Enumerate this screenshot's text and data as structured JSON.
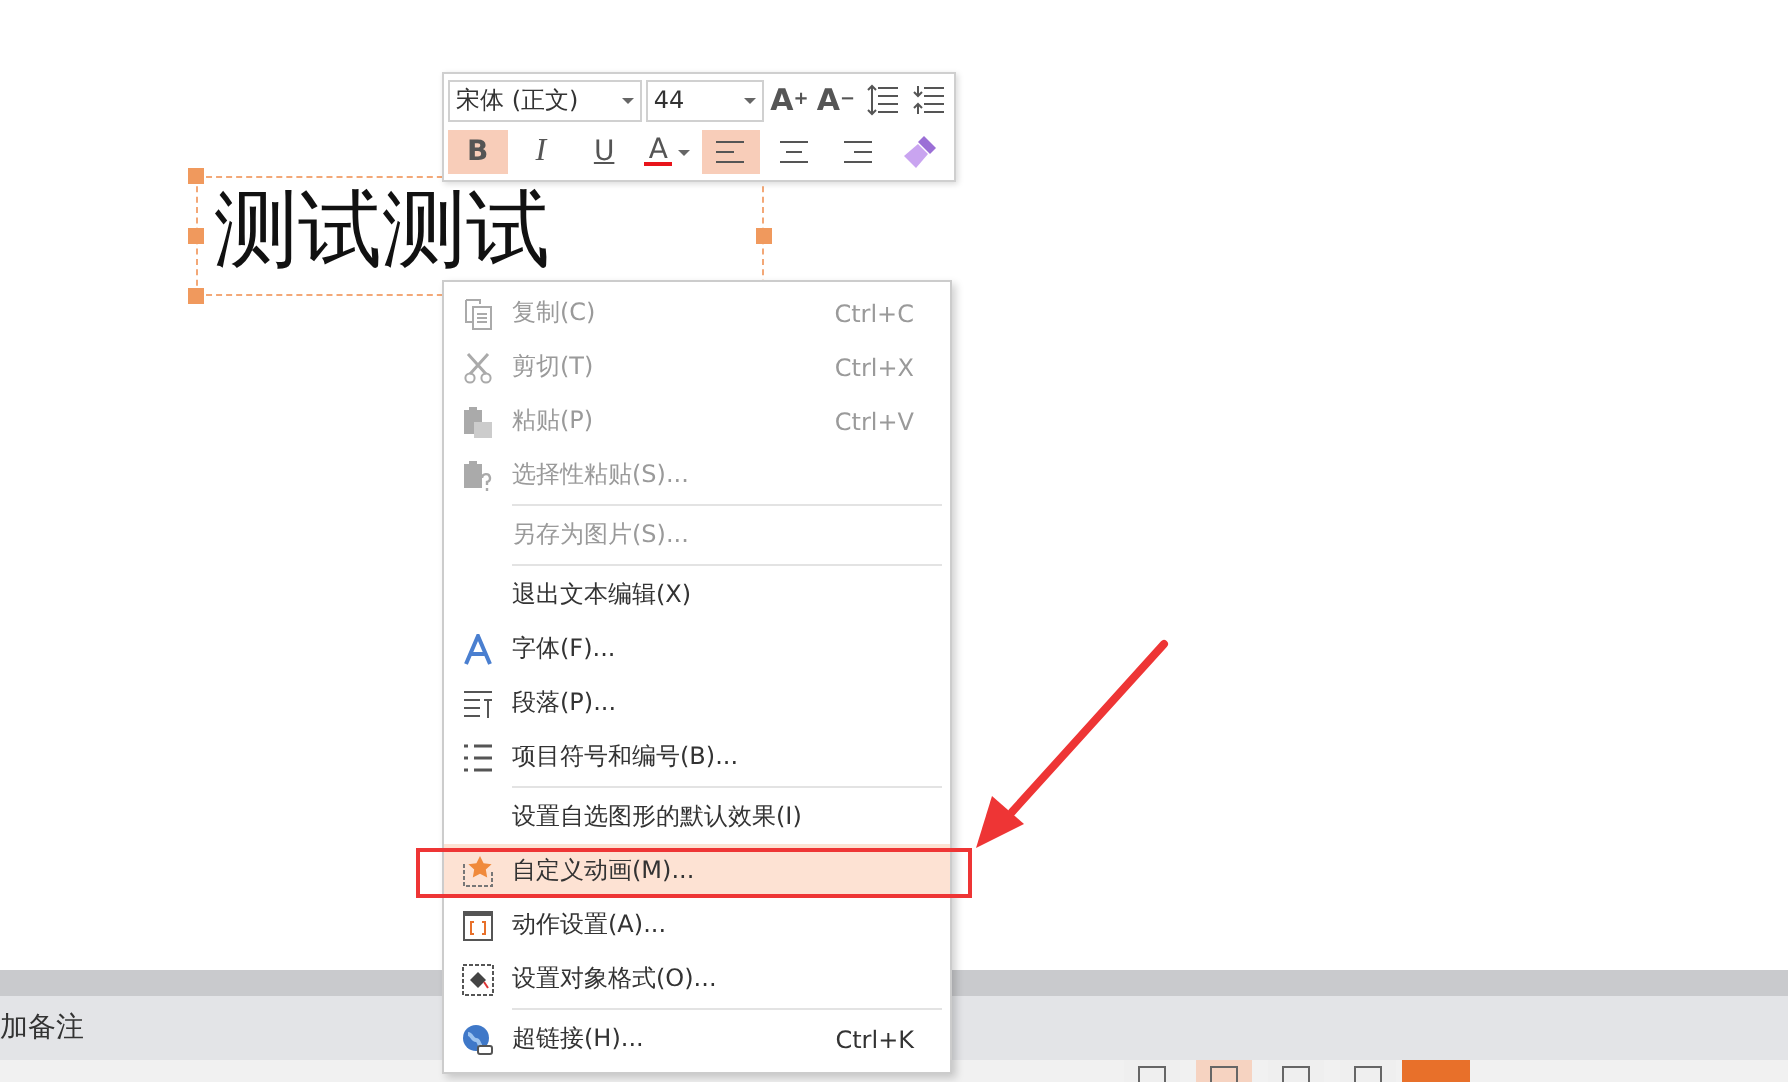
{
  "slide": {
    "text_box": {
      "text": "测试测试"
    }
  },
  "mini_toolbar": {
    "font": "宋体 (正文)",
    "size": "44",
    "top_buttons": [
      {
        "kind": "grow",
        "label": "A$^{+}$"
      },
      {
        "kind": "shrink",
        "label": "A$^{−}$"
      },
      {
        "kind": "spacing"
      },
      {
        "kind": "indent"
      }
    ],
    "format_buttons": [
      {
        "kind": "bold",
        "label": "B",
        "selected": true
      },
      {
        "kind": "italic",
        "label": "I",
        "selected": false
      },
      {
        "kind": "underline",
        "label": "U",
        "selected": false
      },
      {
        "kind": "color",
        "label": "A",
        "color": "#e8141b",
        "selected": false
      },
      {
        "kind": "align-left",
        "selected": true
      },
      {
        "kind": "align-center",
        "selected": false
      },
      {
        "kind": "align-right",
        "selected": false
      },
      {
        "kind": "painter",
        "selected": false
      }
    ]
  },
  "context_menu": {
    "groups": [
      [
        {
          "kind": "copy",
          "label": "复制(C)",
          "shortcut": "Ctrl+C",
          "disabled": true,
          "selected": false
        },
        {
          "kind": "cut",
          "label": "剪切(T)",
          "shortcut": "Ctrl+X",
          "disabled": true,
          "selected": false
        },
        {
          "kind": "paste",
          "label": "粘贴(P)",
          "shortcut": "Ctrl+V",
          "disabled": true,
          "selected": false
        },
        {
          "kind": "paste-special",
          "label": "选择性粘贴(S)...",
          "disabled": true,
          "selected": false
        }
      ],
      [
        {
          "kind": "plain",
          "label": "另存为图片(S)...",
          "disabled": true,
          "selected": false
        }
      ],
      [
        {
          "kind": "plain",
          "label": "退出文本编辑(X)",
          "disabled": false,
          "selected": false
        },
        {
          "kind": "font",
          "label": "字体(F)...",
          "disabled": false,
          "selected": false
        },
        {
          "kind": "paragraph",
          "label": "段落(P)...",
          "disabled": false,
          "selected": false
        },
        {
          "kind": "bullets",
          "label": "项目符号和编号(B)...",
          "disabled": false,
          "selected": false
        }
      ],
      [
        {
          "kind": "plain",
          "label": "设置自选图形的默认效果(I)",
          "disabled": false,
          "selected": false
        },
        {
          "kind": "animation",
          "label": "自定义动画(M)...",
          "disabled": false,
          "selected": true
        },
        {
          "kind": "action",
          "label": "动作设置(A)...",
          "disabled": false,
          "selected": false
        },
        {
          "kind": "format",
          "label": "设置对象格式(O)...",
          "disabled": false,
          "selected": false
        }
      ],
      [
        {
          "kind": "link",
          "label": "超链接(H)...",
          "shortcut": "Ctrl+K",
          "disabled": false,
          "selected": false
        }
      ]
    ]
  },
  "notes_bar": {
    "text": "加备注"
  },
  "status_bar": {
    "views": [
      {
        "selected": false
      },
      {
        "selected": true
      },
      {
        "selected": false
      },
      {
        "selected": false
      }
    ]
  }
}
